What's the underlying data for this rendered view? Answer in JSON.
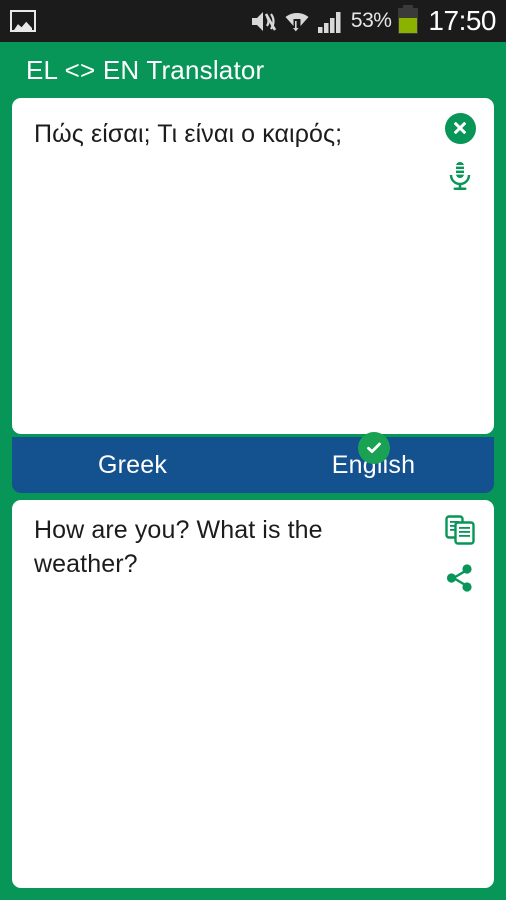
{
  "status_bar": {
    "notification_icon": "gallery-image-icon",
    "mute_icon": "volume-mute-icon",
    "wifi_icon": "wifi-data-transfer-icon",
    "signal_icon": "cellular-signal-icon",
    "battery_percent": "53%",
    "battery_icon": "battery-icon",
    "clock": "17:50",
    "colors": {
      "background": "#1b1b1b",
      "text": "#e8e8e8",
      "battery_fill": "#8cb200"
    }
  },
  "app_bar": {
    "title": "EL <> EN Translator",
    "background": "#079657"
  },
  "input_card": {
    "text": "Πώς είσαι; Τι είναι ο καιρός;",
    "clear_icon": "clear-circle-x-icon",
    "mic_icon": "microphone-icon",
    "icon_color": "#079657"
  },
  "language_bar": {
    "background": "#14528f",
    "source": {
      "label": "Greek",
      "selected": false
    },
    "target": {
      "label": "English",
      "selected": true,
      "badge_icon": "check-circle-icon",
      "badge_color": "#1aa254"
    }
  },
  "output_card": {
    "text": "How are you? What is the weather?",
    "copy_icon": "copy-icon",
    "share_icon": "share-icon",
    "icon_color": "#079657"
  }
}
